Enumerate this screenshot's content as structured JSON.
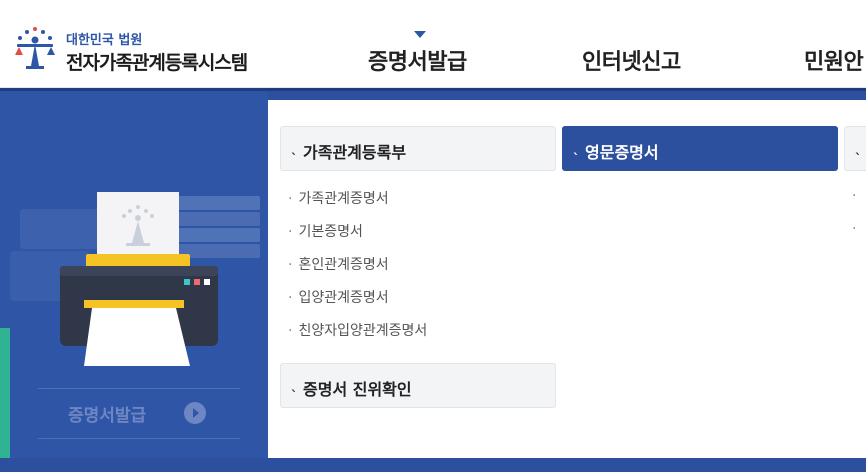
{
  "brand": {
    "org": "대한민국 법원",
    "system": "전자가족관계등록시스템"
  },
  "nav": {
    "items": [
      {
        "label": "증명서발급",
        "active": true
      },
      {
        "label": "인터넷신고"
      },
      {
        "label": "민원안"
      }
    ]
  },
  "side": {
    "caption": "증명서발급",
    "go_icon": "arrow-right-circle-icon"
  },
  "menu": {
    "categories": [
      {
        "label": "가족관계등록부",
        "active": false
      },
      {
        "label": "영문증명서",
        "active": true
      },
      {
        "label": "증명서 진위확인",
        "active": false
      }
    ],
    "sub_items": [
      "가족관계증명서",
      "기본증명서",
      "혼인관계증명서",
      "입양관계증명서",
      "친양자입양관계증명서"
    ],
    "bullet": "·",
    "tick": "ˎ"
  },
  "colors": {
    "brand_blue": "#2c4f9e",
    "accent_green": "#2fb393",
    "printer_yellow": "#f5c323"
  }
}
